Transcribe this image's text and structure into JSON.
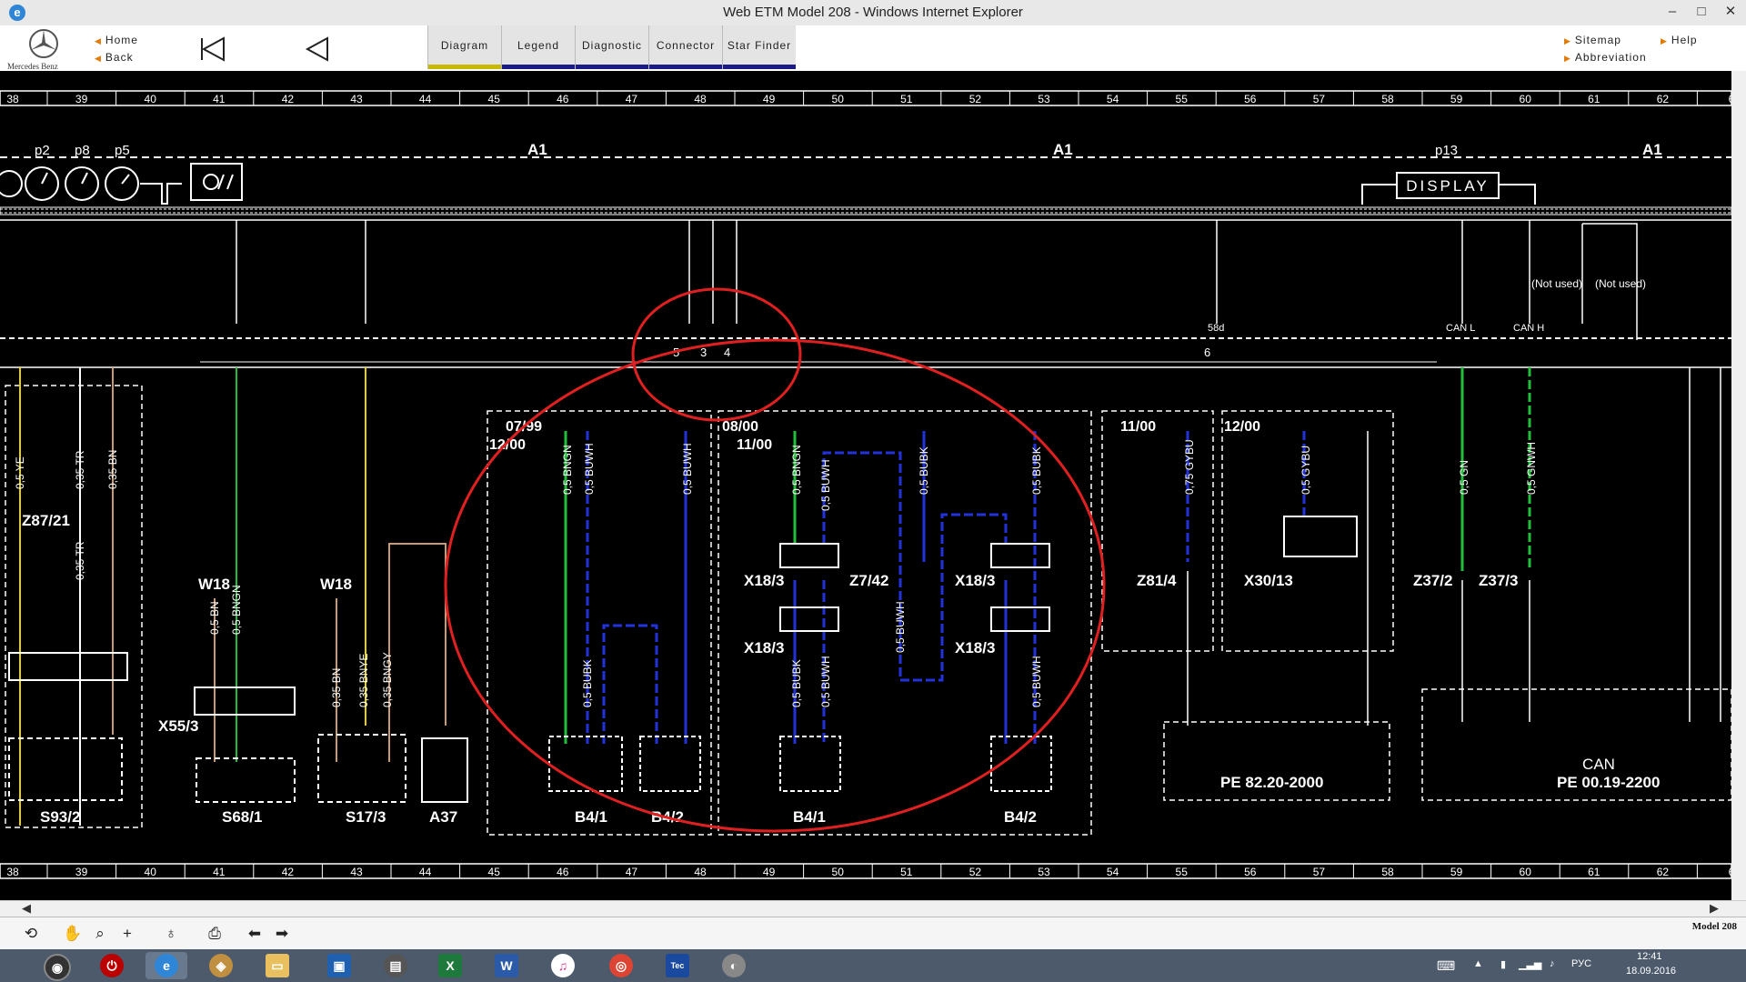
{
  "window": {
    "title": "Web ETM Model 208 - Windows Internet Explorer",
    "minimize": "–",
    "maximize": "□",
    "close": "✕"
  },
  "app": {
    "logo_label": "Mercedes Benz",
    "nav": {
      "home": "Home",
      "back": "Back",
      "sitemap": "Sitemap",
      "help": "Help",
      "abbreviation": "Abbreviation"
    },
    "tabs": [
      {
        "label": "Diagram",
        "active": true
      },
      {
        "label": "Legend",
        "active": false
      },
      {
        "label": "Diagnostic",
        "active": false
      },
      {
        "label": "Connector",
        "active": false
      },
      {
        "label": "Star Finder",
        "active": false
      }
    ]
  },
  "diagram": {
    "grid_numbers": [
      "38",
      "39",
      "40",
      "41",
      "42",
      "43",
      "44",
      "45",
      "46",
      "47",
      "48",
      "49",
      "50",
      "51",
      "52",
      "53",
      "54",
      "55",
      "56",
      "57",
      "58",
      "59",
      "60",
      "61",
      "62",
      "6"
    ],
    "module_labels": [
      "A1",
      "A1",
      "A1"
    ],
    "pins_top": [
      "p2",
      "p8",
      "p5",
      "p13"
    ],
    "display_label": "DISPLAY",
    "not_used": [
      "(Not used)",
      "(Not used)"
    ],
    "connector_pins": [
      "5",
      "3",
      "4",
      "6"
    ],
    "can_labels": [
      "CAN L",
      "CAN H"
    ],
    "pin_58d": "58d",
    "components": {
      "z87_21": "Z87/21",
      "w18a": "W18",
      "w18b": "W18",
      "x55_3": "X55/3",
      "s93_2": "S93/2",
      "s68_1": "S68/1",
      "s17_3": "S17/3",
      "a37": "A37",
      "b4_1a": "B4/1",
      "b4_2a": "B4/2",
      "b4_1b": "B4/1",
      "b4_2b": "B4/2",
      "x18_3a": "X18/3",
      "x18_3b": "X18/3",
      "x18_3c": "X18/3",
      "x18_3d": "X18/3",
      "z7_42": "Z7/42",
      "z81_4": "Z81/4",
      "x30_13": "X30/13",
      "z37_2": "Z37/2",
      "z37_3": "Z37/3"
    },
    "date_labels": {
      "d0799": "07/99",
      "d1200a": "12/00",
      "d0800": "08/00",
      "d1100a": "11/00",
      "d1100b": "11/00",
      "d1200b": "12/00"
    },
    "wires": [
      "0,5 YE",
      "0,35 TR",
      "0,35 BN",
      "0,35 TR",
      "0,5 BN",
      "0,5 BNGN",
      "0,35 BN",
      "0,35 BNYE",
      "0,35 BNGY",
      "0,5 BNGN",
      "0,5 BUWH",
      "0,5 BUBK",
      "0,5 BUWH",
      "0,5 BNGN",
      "0,5 BUWH",
      "0,5 BUBK",
      "0,5 BUBK",
      "0,5 BUWH",
      "0,5 BUBK",
      "0,5 BUWH",
      "0,5 BUWH",
      "0,75 GYBU",
      "0,5 GYBU",
      "0,5 GN",
      "0,5 GNWH"
    ],
    "pe_refs": {
      "pe1": "PE 82.20-2000",
      "can": "CAN",
      "pe2": "PE 00.19-2200"
    },
    "colors": {
      "annotation": "#e02020",
      "wire_green": "#22c03a",
      "wire_blue": "#2233dd",
      "wire_yellow": "#e8d000",
      "wire_brown": "#c89a70"
    }
  },
  "toolbar": {
    "model_label": "Model 208"
  },
  "taskbar": {
    "time": "12:41",
    "date": "18.09.2016",
    "lang": "РУС"
  }
}
